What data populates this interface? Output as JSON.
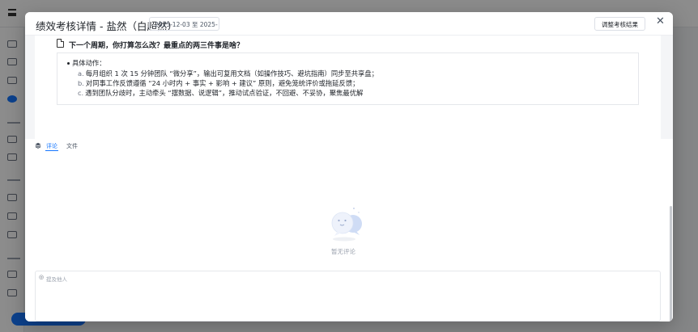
{
  "modal": {
    "title": "绩效考核详情 - 盐然（白超然）",
    "date_range": "2025-12-03 至 2025-",
    "adjust_button": "调整考核结果",
    "close": "✕"
  },
  "question": {
    "title": "下一个周期，你打算怎么改？最重点的两三件事是啥？"
  },
  "answer": {
    "heading": "具体动作：",
    "items": [
      {
        "num": "a.",
        "text": "每月组织 1 次 15 分钟团队 “微分享”，输出可复用文档（如操作技巧、避坑指南）同步至共享盘；"
      },
      {
        "num": "b.",
        "text": "对同事工作反馈遵循 “24 小时内 + 事实 + 影响 + 建议” 原则，避免笼统评价或拖延反馈；"
      },
      {
        "num": "c.",
        "text": "遇到团队分歧时，主动牵头 “摆数据、说逻辑”，推动试点验证，不回避、不妥协，聚焦最优解"
      }
    ]
  },
  "tabs": {
    "comment": "评论",
    "file": "文件"
  },
  "empty": {
    "text": "暂无评论"
  },
  "comment_input": {
    "placeholder": "提及他人"
  },
  "colors": {
    "accent": "#1677ff",
    "overlay": "rgba(0,0,0,0.45)"
  }
}
